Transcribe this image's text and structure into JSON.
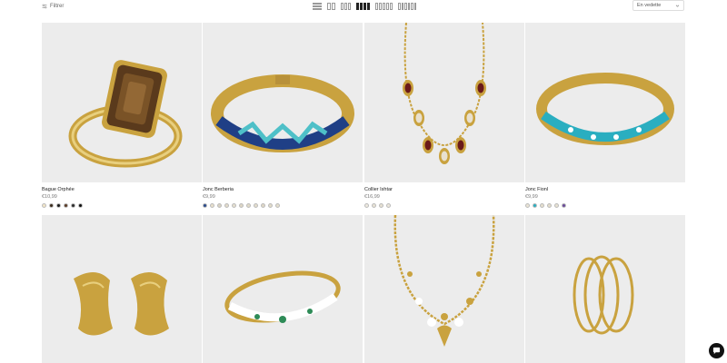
{
  "toolbar": {
    "filter_label": "Filtrer",
    "sort_label": "En vedette",
    "grid_options": [
      "list",
      "grid-2",
      "grid-3",
      "grid-4",
      "grid-5",
      "grid-6"
    ],
    "active_grid": "grid-4"
  },
  "products": [
    {
      "name": "Bague Orphée",
      "price": "€10,99",
      "image": "ring-smoky-stone",
      "swatches": [
        "#f2e6c9",
        "#3a2a1a",
        "#1a1a1a",
        "#5a3b25",
        "#2b2b2b",
        "#0f0f0f"
      ]
    },
    {
      "name": "Jonc Berberia",
      "price": "€9,99",
      "image": "bangle-blue-enamel",
      "swatches": [
        "#2a4a8a",
        "#e8e0cc",
        "#d9d4c4",
        "#e3dccb",
        "#e6e0d0",
        "#ddd6c5",
        "#e1dbc9",
        "#e4decd",
        "#dfd8c6",
        "#e2dcca",
        "#e5dfce"
      ]
    },
    {
      "name": "Collier Ishtar",
      "price": "€16,99",
      "image": "necklace-red-stones",
      "swatches": [
        "#eeeae0",
        "#e9e3d6",
        "#e6e0d2",
        "#ece7dc"
      ]
    },
    {
      "name": "Jonc Fionl",
      "price": "€9,99",
      "image": "bangle-turquoise",
      "swatches": [
        "#eae4d6",
        "#2aaec0",
        "#e6dfce",
        "#e4ddcc",
        "#e8e2d3",
        "#6a4a9a"
      ]
    },
    {
      "name": "",
      "price": "",
      "image": "earrings-gold-wave",
      "swatches": []
    },
    {
      "name": "",
      "price": "",
      "image": "bangle-white-enamel",
      "swatches": []
    },
    {
      "name": "",
      "price": "",
      "image": "necklace-charms",
      "swatches": []
    },
    {
      "name": "",
      "price": "",
      "image": "hoops-gold-triple",
      "swatches": []
    }
  ],
  "colors": {
    "gold": "#c9a23f",
    "image_bg": "#ececec",
    "chat_bg": "#111111"
  }
}
